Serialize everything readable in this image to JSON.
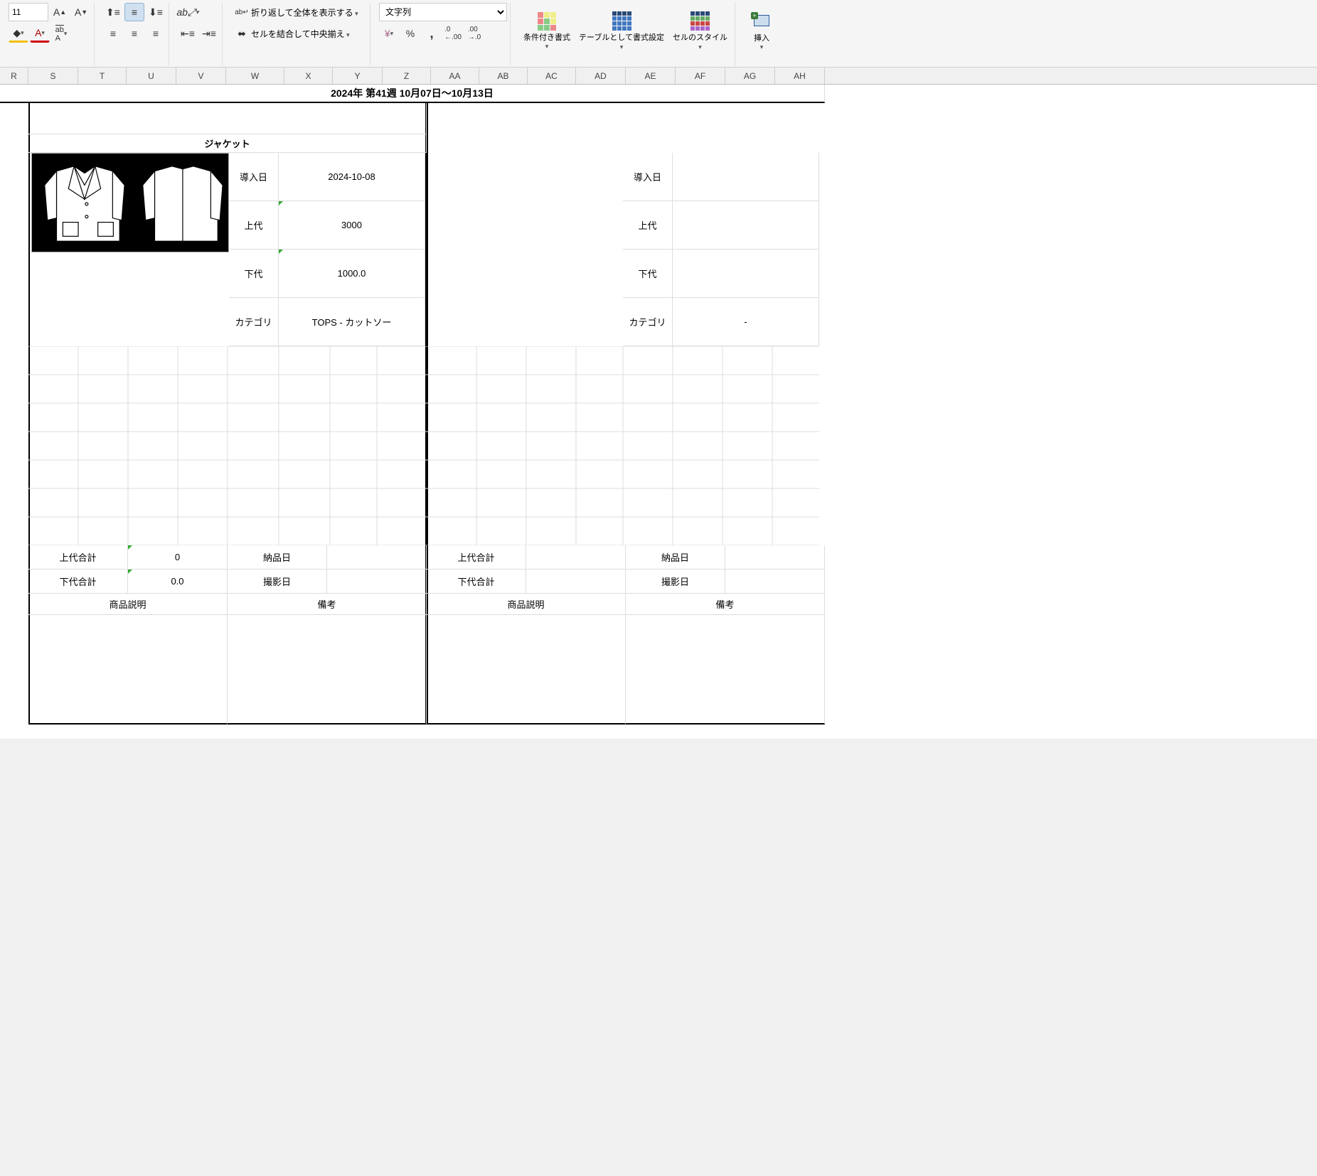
{
  "ribbon": {
    "font_size": "11",
    "wrap_text_label": "折り返して全体を表示する",
    "merge_center_label": "セルを結合して中央揃え",
    "number_format": "文字列",
    "cond_fmt_label": "条件付き書式",
    "table_fmt_label": "テーブルとして書式設定",
    "cell_styles_label": "セルのスタイル",
    "insert_label": "挿入"
  },
  "columns": [
    "R",
    "S",
    "T",
    "U",
    "V",
    "W",
    "X",
    "Y",
    "Z",
    "AA",
    "AB",
    "AC",
    "AD",
    "AE",
    "AF",
    "AG",
    "AH"
  ],
  "header_week": "2024年 第41週 10月07日～10月13日",
  "left": {
    "title": "ジャケット",
    "fields": {
      "intro_date_label": "導入日",
      "intro_date": "2024-10-08",
      "joudai_label": "上代",
      "joudai": "3000",
      "gedai_label": "下代",
      "gedai": "1000.0",
      "category_label": "カテゴリ",
      "category": "TOPS - カットソー"
    },
    "totals": {
      "joudai_total_label": "上代合計",
      "joudai_total": "0",
      "gedai_total_label": "下代合計",
      "gedai_total": "0.0",
      "nouhin_label": "納品日",
      "satsuei_label": "撮影日"
    },
    "desc_label": "商品説明",
    "remarks_label": "備考"
  },
  "right": {
    "fields": {
      "intro_date_label": "導入日",
      "joudai_label": "上代",
      "gedai_label": "下代",
      "category_label": "カテゴリ",
      "category": "-"
    },
    "totals": {
      "joudai_total_label": "上代合計",
      "gedai_total_label": "下代合計",
      "nouhin_label": "納品日",
      "satsuei_label": "撮影日"
    },
    "desc_label": "商品説明",
    "remarks_label": "備考"
  }
}
